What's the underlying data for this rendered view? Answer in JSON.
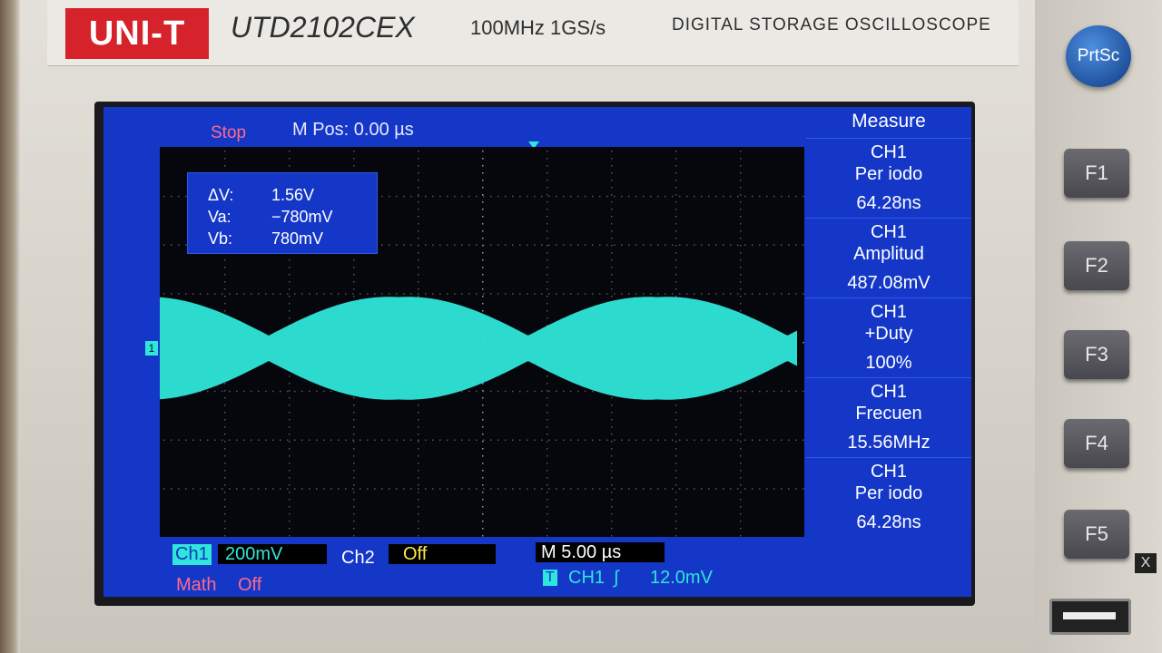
{
  "brand": {
    "logo": "UNI-T",
    "model": "UTD2102CEX",
    "spec": "100MHz  1GS/s",
    "description": "DIGITAL STORAGE OSCILLOSCOPE"
  },
  "screen": {
    "status": "Stop",
    "mpos": "M Pos: 0.00 µs",
    "ch1_marker": "1",
    "cursors": [
      {
        "label": "ΔV:",
        "value": "1.56V"
      },
      {
        "label": "Va:",
        "value": "−780mV"
      },
      {
        "label": "Vb:",
        "value": "780mV"
      }
    ],
    "measure": {
      "title": "Measure",
      "items": [
        {
          "channel": "CH1",
          "name": "Per iodo",
          "value": "64.28ns"
        },
        {
          "channel": "CH1",
          "name": "Amplitud",
          "value": "487.08mV"
        },
        {
          "channel": "CH1",
          "name": "+Duty",
          "value": "100%"
        },
        {
          "channel": "CH1",
          "name": "Frecuen",
          "value": "15.56MHz"
        },
        {
          "channel": "CH1",
          "name": "Per iodo",
          "value": "64.28ns"
        }
      ]
    },
    "bottom": {
      "ch1_label": "Ch1",
      "ch1_scale": "200mV",
      "ch2_label": "Ch2",
      "ch2_value": "Off",
      "math_label": "Math",
      "math_value": "Off",
      "timebase": "M 5.00 µs",
      "trigger_icon": "T",
      "trigger_source": "CH1",
      "trigger_slope": "∫",
      "trigger_level": "12.0mV"
    },
    "colors": {
      "trace": "#2ee6d9",
      "screen_bg": "#1437c8",
      "stop": "#ff6a8a"
    }
  },
  "buttons": {
    "prtsc": "PrtSc",
    "f1": "F1",
    "f2": "F2",
    "f3": "F3",
    "f4": "F4",
    "f5": "F5",
    "close_icon": "X"
  }
}
